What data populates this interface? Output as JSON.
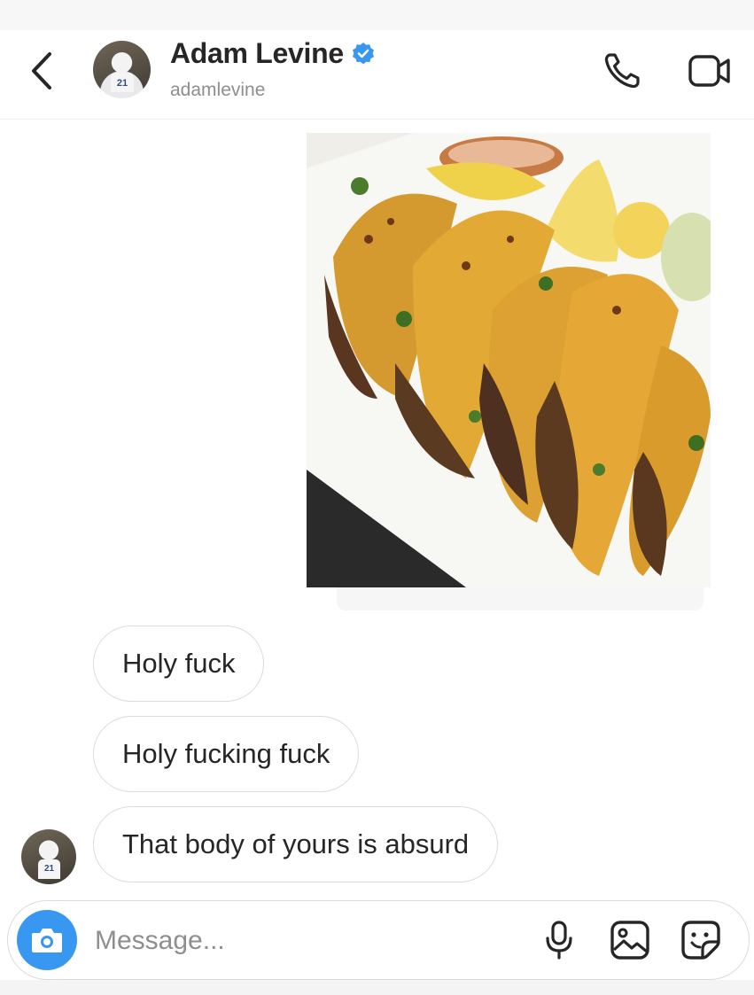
{
  "header": {
    "name": "Adam Levine",
    "handle": "adamlevine",
    "avatar_jersey": "21",
    "verified": true,
    "icons": [
      "back-chevron-icon",
      "verified-badge-icon",
      "phone-icon",
      "video-camera-icon"
    ]
  },
  "messages": [
    {
      "type": "image",
      "description_icon": "food-photo"
    },
    {
      "type": "text",
      "text": "Holy fuck"
    },
    {
      "type": "text",
      "text": "Holy fucking fuck"
    },
    {
      "type": "text",
      "text": "That body of yours is absurd"
    }
  ],
  "composer": {
    "placeholder": "Message...",
    "icons": [
      "camera-icon",
      "microphone-icon",
      "gallery-icon",
      "sticker-icon"
    ]
  },
  "colors": {
    "accent_blue": "#3897f0",
    "text": "#262626",
    "muted": "#8e8e8e",
    "border": "#dbdbdb"
  }
}
